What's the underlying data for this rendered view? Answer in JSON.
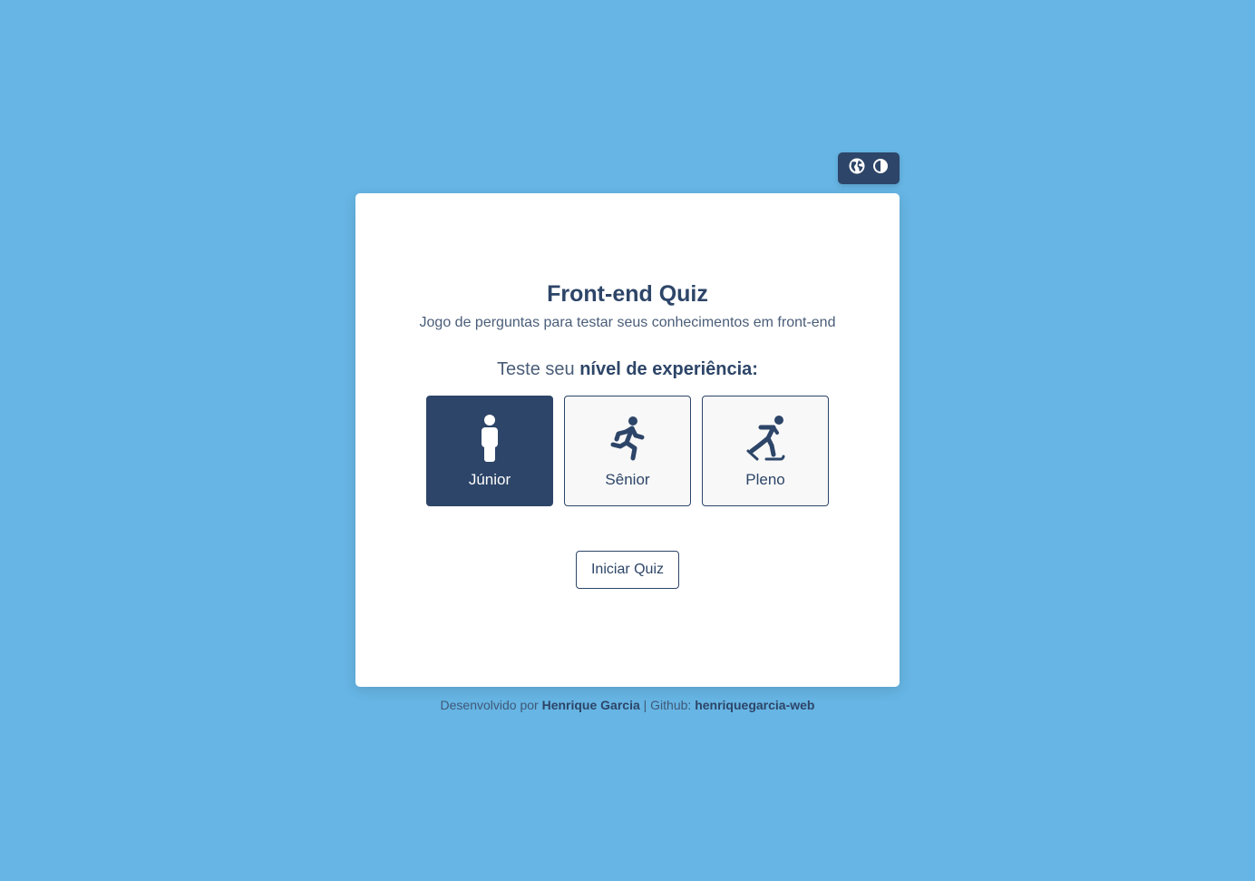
{
  "toolbar": {
    "language_icon": "globe-icon",
    "theme_icon": "contrast-icon"
  },
  "card": {
    "title": "Front-end Quiz",
    "subtitle": "Jogo de perguntas para testar seus conhecimentos em front-end",
    "prompt_prefix": "Teste seu ",
    "prompt_bold": "nível de experiência:"
  },
  "levels": [
    {
      "label": "Júnior",
      "icon": "person-standing-icon",
      "selected": true
    },
    {
      "label": "Sênior",
      "icon": "person-running-icon",
      "selected": false
    },
    {
      "label": "Pleno",
      "icon": "person-skating-icon",
      "selected": false
    }
  ],
  "start_button": {
    "label": "Iniciar Quiz"
  },
  "footer": {
    "dev_prefix": "Desenvolvido por ",
    "dev_name": "Henrique Garcia",
    "github_prefix": " | Github: ",
    "github_user": "henriquegarcia-web"
  },
  "colors": {
    "background": "#66b5e4",
    "primary": "#2d4568",
    "card": "#ffffff"
  }
}
